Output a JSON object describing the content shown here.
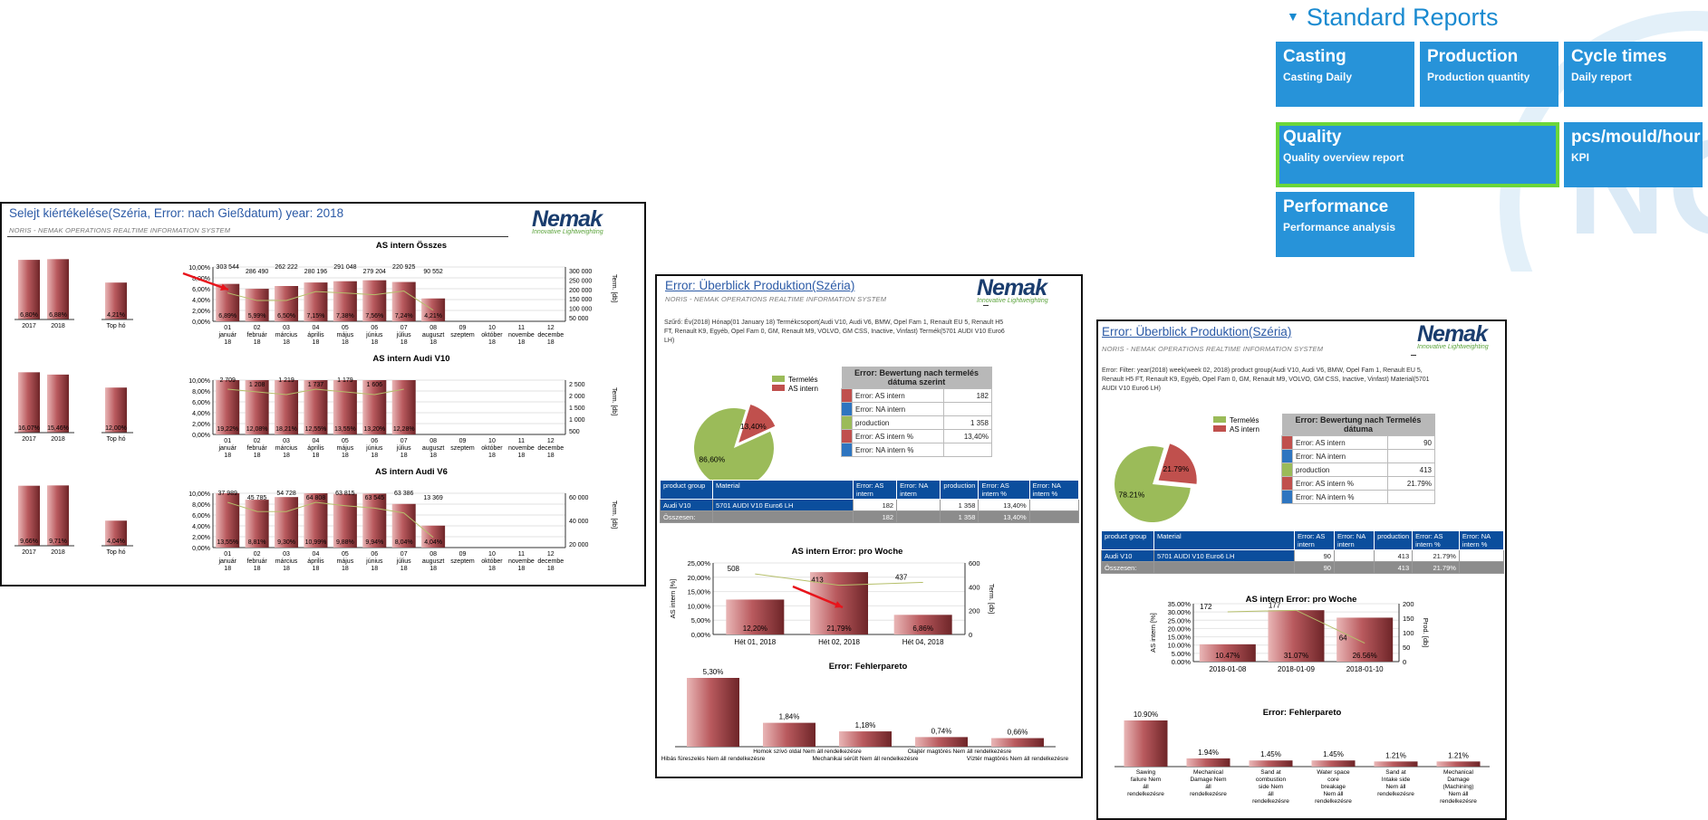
{
  "standard_reports": {
    "title": "Standard Reports",
    "background_text": "NOI",
    "tiles": [
      {
        "title": "Casting",
        "subtitle": "Casting Daily"
      },
      {
        "title": "Production",
        "subtitle": "Production quantity"
      },
      {
        "title": "Cycle times",
        "subtitle": "Daily report"
      },
      {
        "title": "Quality",
        "subtitle": "Quality overview report",
        "selected": true
      },
      {
        "title": "pcs/mould/hour",
        "subtitle": "KPI"
      },
      {
        "title": "Performance",
        "subtitle": "Performance analysis"
      }
    ]
  },
  "report1": {
    "title": "Selejt kiértékelése(Széria, Error: nach Gießdatum) year: 2018",
    "subtitle": "NORIS - NEMAK OPERATIONS REALTIME INFORMATION SYSTEM",
    "logo": {
      "name": "Nemak",
      "tagline": "Innovative Lightweighting"
    },
    "summary_categories": [
      "2017",
      "2018",
      "Top hó"
    ],
    "month_labels": [
      "01 január 18",
      "02 február 18",
      "03 március 18",
      "04 április 18",
      "05 május 18",
      "06 június 18",
      "07 július 18",
      "08 augusztus 18",
      "09 szeptember...",
      "10 október 18",
      "11 november 18",
      "12 december 18"
    ],
    "y_ticks": [
      "10,00%",
      "8,00%",
      "6,00%",
      "4,00%",
      "2,00%",
      "0,00%"
    ],
    "right_axis_label": "Term. [db]",
    "charts": [
      {
        "title": "AS intern Összes",
        "summary_labels": [
          "6,80%",
          "6,88%",
          "4,21%"
        ],
        "summary_values": [
          6.8,
          6.88,
          4.21
        ],
        "right_ticks": [
          "300 000",
          "250 000",
          "200 000",
          "150 000",
          "100 000",
          "50 000"
        ],
        "pct_labels": [
          "6,89%",
          "5,99%",
          "6,50%",
          "7,15%",
          "7,38%",
          "7,56%",
          "7,24%",
          "4,21%",
          "",
          "",
          "",
          ""
        ],
        "pct_values": [
          6.89,
          5.99,
          6.5,
          7.15,
          7.38,
          7.56,
          7.24,
          4.21,
          0,
          0,
          0,
          0
        ],
        "prod_labels": [
          "303 544",
          "286 490",
          "262 222",
          "280 196",
          "291 048",
          "279 204",
          "220 925",
          "90 552",
          "",
          "",
          "",
          ""
        ]
      },
      {
        "title": "AS intern Audi V10",
        "summary_labels": [
          "16,07%",
          "15,46%",
          "12,00%"
        ],
        "summary_values": [
          16.07,
          15.46,
          12.0
        ],
        "right_ticks": [
          "2 500",
          "2 000",
          "1 500",
          "1 000",
          "500"
        ],
        "pct_labels": [
          "19,22%",
          "12,08%",
          "18,21%",
          "12,55%",
          "13,55%",
          "13,20%",
          "12,28%",
          "",
          "",
          "",
          "",
          ""
        ],
        "pct_values": [
          19.22,
          12.08,
          18.21,
          12.55,
          13.55,
          13.2,
          12.28,
          0,
          0,
          0,
          0,
          0
        ],
        "prod_labels": [
          "2 709",
          "1 208",
          "1 219",
          "1 737",
          "1 179",
          "1 606",
          "",
          "",
          "",
          "",
          "",
          ""
        ]
      },
      {
        "title": "AS intern Audi V6",
        "summary_labels": [
          "9,66%",
          "9,71%",
          "4,04%"
        ],
        "summary_values": [
          9.66,
          9.71,
          4.04
        ],
        "right_ticks": [
          "60 000",
          "40 000",
          "20 000"
        ],
        "pct_labels": [
          "13,55%",
          "8,81%",
          "9,30%",
          "10,99%",
          "9,88%",
          "9,94%",
          "8,04%",
          "4,04%",
          "",
          "",
          "",
          ""
        ],
        "pct_values": [
          13.55,
          8.81,
          9.3,
          10.99,
          9.88,
          9.94,
          8.04,
          4.04,
          0,
          0,
          0,
          0
        ],
        "prod_labels": [
          "37 989",
          "45 785",
          "54 728",
          "64 808",
          "63 815",
          "63 545",
          "63 386",
          "13 369",
          "",
          "",
          "",
          ""
        ]
      }
    ]
  },
  "report2": {
    "title": "Error: Überblick Produktion(Széria)",
    "subtitle": "NORIS - NEMAK OPERATIONS REALTIME INFORMATION SYSTEM",
    "logo": {
      "name": "Nemak",
      "tagline": "Innovative Lightweighting"
    },
    "filter": "Szűrő: Év(2018) Hónap(01 January 18) Termékcsoport(Audi V10, Audi V6, BMW, Opel Fam 1, Renault EU 5, Renault H5 FT, Renault K9, Egyéb, Opel Fam 0, GM, Renault M9, VOLVO, GM CSS, Inactive, Vinfast) Termék(5701 AUDI V10 Euro6 LH)",
    "pie": {
      "legend": [
        "Termelés",
        "AS intern"
      ],
      "labels": [
        "86,60%",
        "13,40%"
      ],
      "values": [
        86.6,
        13.4
      ]
    },
    "breakdown": {
      "header_plain": "Error: Bewertung nach",
      "header_bold": "termelés dátuma szerint",
      "rows": [
        {
          "label": "Error: AS intern",
          "value": "182",
          "color": "#c0504d"
        },
        {
          "label": "Error: NA intern",
          "value": "",
          "color": "#2e75c0"
        },
        {
          "label": "production",
          "value": "1 358",
          "color": "#9bbb59"
        },
        {
          "label": "Error: AS intern %",
          "value": "13,40%",
          "color": "#c0504d"
        },
        {
          "label": "Error: NA intern %",
          "value": "",
          "color": "#2e75c0"
        }
      ]
    },
    "table": {
      "headers": [
        "product group",
        "Material",
        "Error: AS intern",
        "Error: NA intern",
        "production",
        "Error: AS intern %",
        "Error: NA intern %"
      ],
      "rows": [
        [
          "Audi V10",
          "5701 AUDI V10 Euro6 LH",
          "182",
          "",
          "1 358",
          "13,40%",
          ""
        ]
      ],
      "total": [
        "Összesen:",
        "",
        "182",
        "",
        "1 358",
        "13,40%",
        ""
      ]
    },
    "weekly": {
      "title": "AS intern Error: pro Woche",
      "y_label": "AS intern [%]",
      "y2_label": "Term. [db]",
      "y_ticks": [
        "25,00%",
        "20,00%",
        "15,00%",
        "10,00%",
        "5,00%",
        "0,00%"
      ],
      "y2_ticks": [
        "600",
        "400",
        "200",
        "0"
      ],
      "categories": [
        "Hét 01, 2018",
        "Hét 02, 2018",
        "Hét 04, 2018"
      ],
      "pct_labels": [
        "12,20%",
        "21,79%",
        "6,86%"
      ],
      "pct_values": [
        12.2,
        21.79,
        6.86
      ],
      "prod_labels": [
        "508",
        "413",
        "437"
      ],
      "prod_values": [
        508,
        413,
        437
      ]
    },
    "pareto": {
      "title": "Error: Fehlerpareto",
      "values": [
        5.3,
        1.84,
        1.18,
        0.74,
        0.66
      ],
      "labels": [
        "5,30%",
        "1,84%",
        "1,18%",
        "0,74%",
        "0,66%"
      ],
      "categories": [
        "Hibás füreszelés Nem áll rendelkezésre",
        "Homok szívó oldal Nem áll rendelkezésre",
        "Mechanikai sérült Nem áll rendelkezésre",
        "Olajtér magtörés Nem áll rendelkezésre",
        "Víztér magtörés Nem áll rendelkezésre"
      ]
    }
  },
  "report3": {
    "title": "Error: Überblick Produktion(Széria)",
    "subtitle": "NORIS - NEMAK OPERATIONS REALTIME INFORMATION SYSTEM",
    "logo": {
      "name": "Nemak",
      "tagline": "Innovative Lightweighting"
    },
    "filter": "Error: Filter: year(2018) week(week 02, 2018) product group(Audi V10, Audi V6, BMW, Opel Fam 1, Renault EU 5, Renault H5 FT, Renault K9, Egyéb, Opel Fam 0, GM, Renault M9, VOLVO, GM CSS, Inactive, Vinfast) Material(5701 AUDI V10 Euro6 LH)",
    "pie": {
      "legend": [
        "Termelés",
        "AS intern"
      ],
      "labels": [
        "78.21%",
        "21.79%"
      ],
      "values": [
        78.21,
        21.79
      ]
    },
    "breakdown": {
      "header_plain": "Error: Bewertung nach",
      "header_bold": "Termelés dátuma",
      "rows": [
        {
          "label": "Error: AS intern",
          "value": "90",
          "color": "#c0504d"
        },
        {
          "label": "Error: NA intern",
          "value": "",
          "color": "#2e75c0"
        },
        {
          "label": "production",
          "value": "413",
          "color": "#9bbb59"
        },
        {
          "label": "Error: AS intern %",
          "value": "21.79%",
          "color": "#c0504d"
        },
        {
          "label": "Error: NA intern %",
          "value": "",
          "color": "#2e75c0"
        }
      ]
    },
    "table": {
      "headers": [
        "product group",
        "Material",
        "Error: AS intern",
        "Error: NA intern",
        "production",
        "Error: AS intern %",
        "Error: NA intern %"
      ],
      "rows": [
        [
          "Audi V10",
          "5701 AUDI V10 Euro6 LH",
          "90",
          "",
          "413",
          "21.79%",
          ""
        ]
      ],
      "total": [
        "Összesen:",
        "",
        "90",
        "",
        "413",
        "21.79%",
        ""
      ]
    },
    "weekly": {
      "title": "AS intern Error: pro Woche",
      "y_label": "AS intern [%]",
      "y2_label": "Prod. [db]",
      "y_ticks": [
        "35.00%",
        "30.00%",
        "25.00%",
        "20.00%",
        "15.00%",
        "10.00%",
        "5.00%",
        "0.00%"
      ],
      "y2_ticks": [
        "200",
        "150",
        "100",
        "50",
        "0"
      ],
      "categories": [
        "2018-01-08",
        "2018-01-09",
        "2018-01-10"
      ],
      "pct_labels": [
        "10.47%",
        "31.07%",
        "26.56%"
      ],
      "pct_values": [
        10.47,
        31.07,
        26.56
      ],
      "prod_labels": [
        "172",
        "177",
        "64"
      ],
      "prod_values": [
        172,
        177,
        64
      ]
    },
    "pareto": {
      "title": "Error: Fehlerpareto",
      "values": [
        10.9,
        1.94,
        1.45,
        1.45,
        1.21,
        1.21
      ],
      "labels": [
        "10.90%",
        "1.94%",
        "1.45%",
        "1.45%",
        "1.21%",
        "1.21%"
      ],
      "categories": [
        "Sawing failure Nem áll rendelkezésre",
        "Mechanical Damage Nem áll rendelkezésre",
        "Sand at combustion side Nem áll rendelkezésre",
        "Water space core breakage Nem áll rendelkezésre",
        "Sand at Intake side Nem áll rendelkezésre",
        "Mechanical Damage (Machining) Nem áll rendelkezésre"
      ]
    }
  }
}
